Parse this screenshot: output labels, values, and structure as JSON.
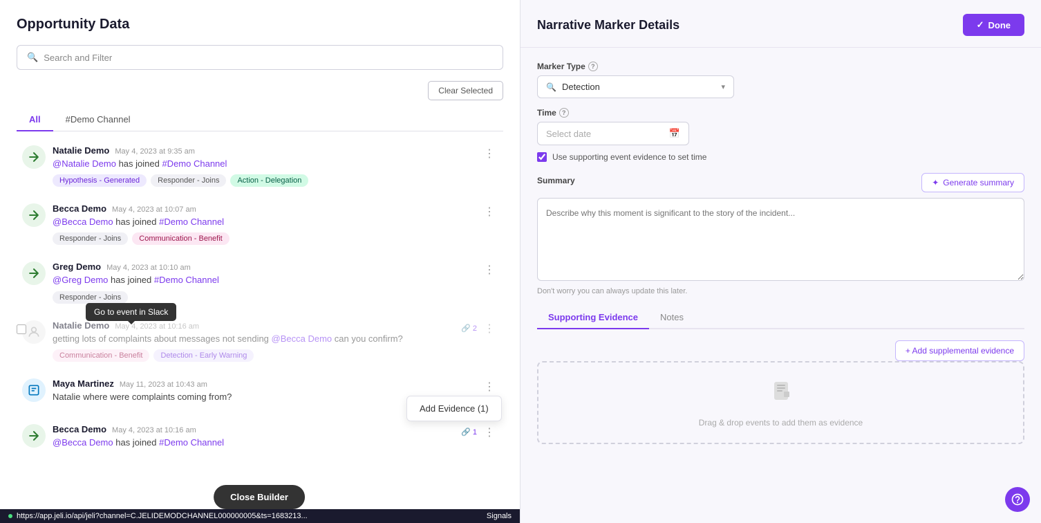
{
  "leftPanel": {
    "title": "Opportunity Data",
    "search": {
      "placeholder": "Search and Filter"
    },
    "clearSelected": "Clear Selected",
    "tabs": [
      {
        "label": "All",
        "active": true
      },
      {
        "label": "#Demo Channel",
        "active": false
      }
    ],
    "messages": [
      {
        "id": 1,
        "author": "Natalie Demo",
        "time": "May 4, 2023 at 9:35 am",
        "text": "@Natalie Demo has joined #Demo Channel",
        "tags": [
          {
            "label": "Hypothesis - Generated",
            "type": "purple"
          },
          {
            "label": "Responder - Joins",
            "type": "gray"
          },
          {
            "label": "Action - Delegation",
            "type": "green-tag"
          }
        ],
        "hasMore": true,
        "avatarType": "arrow"
      },
      {
        "id": 2,
        "author": "Becca Demo",
        "time": "May 4, 2023 at 10:07 am",
        "text": "@Becca Demo has joined #Demo Channel",
        "tags": [
          {
            "label": "Responder - Joins",
            "type": "gray"
          },
          {
            "label": "Communication - Benefit",
            "type": "pink"
          }
        ],
        "hasMore": true,
        "avatarType": "arrow"
      },
      {
        "id": 3,
        "author": "Greg Demo",
        "time": "May 4, 2023 at 10:10 am",
        "text": "@Greg Demo has joined #Demo Channel",
        "tags": [
          {
            "label": "Responder - Joins",
            "type": "gray"
          }
        ],
        "hasMore": true,
        "avatarType": "arrow",
        "showTooltip": true
      },
      {
        "id": 4,
        "author": "Natalie Demo",
        "time": "May 4, 2023 at 10:16 am",
        "text": "getting lots of complaints about messages not sending @Becca Demo can you confirm?",
        "tags": [
          {
            "label": "Communication - Benefit",
            "type": "pink"
          },
          {
            "label": "Detection - Early Warning",
            "type": "purple"
          }
        ],
        "hasMore": true,
        "linkCount": 2,
        "dimmed": true,
        "showAddEvidence": true
      },
      {
        "id": 5,
        "author": "Maya Martinez",
        "time": "May 11, 2023 at 10:43 am",
        "text": "Natalie where were complaints coming from?",
        "tags": [],
        "hasMore": true,
        "avatarType": "doc"
      },
      {
        "id": 6,
        "author": "Becca Demo",
        "time": "May 4, 2023 at 10:16 am",
        "text": "@Becca Demo has joined #Demo Channel",
        "tags": [],
        "hasMore": true,
        "linkCount": 1,
        "avatarType": "arrow"
      }
    ],
    "tooltipText": "Go to event in Slack",
    "addEvidenceText": "Add Evidence (1)"
  },
  "rightPanel": {
    "title": "Narrative Marker Details",
    "doneButton": "Done",
    "markerType": {
      "label": "Marker Type",
      "value": "Detection"
    },
    "time": {
      "label": "Time",
      "placeholder": "Select date",
      "useEvidence": "Use supporting event evidence to set time"
    },
    "summary": {
      "label": "Summary",
      "generateButton": "Generate summary",
      "placeholder": "Describe why this moment is significant to the story of the incident...",
      "hint": "Don't worry you can always update this later."
    },
    "tabs": [
      {
        "label": "Supporting Evidence",
        "active": true
      },
      {
        "label": "Notes",
        "active": false
      }
    ],
    "addSupplementalButton": "+ Add supplemental evidence",
    "dropZone": "Drag & drop events to add them as evidence",
    "closeBuilder": "Close Builder"
  },
  "statusBar": {
    "url": "https://app.jeli.io/api/jeli?channel=C.JELIDEMODCHANNEL000000005&ts=1683213...",
    "label": "Signals"
  },
  "icons": {
    "search": "🔍",
    "calendar": "📅",
    "chevronDown": "▾",
    "sparkle": "✦",
    "checkmark": "✓",
    "link": "🔗",
    "dropFile": "📋",
    "plus": "+"
  }
}
